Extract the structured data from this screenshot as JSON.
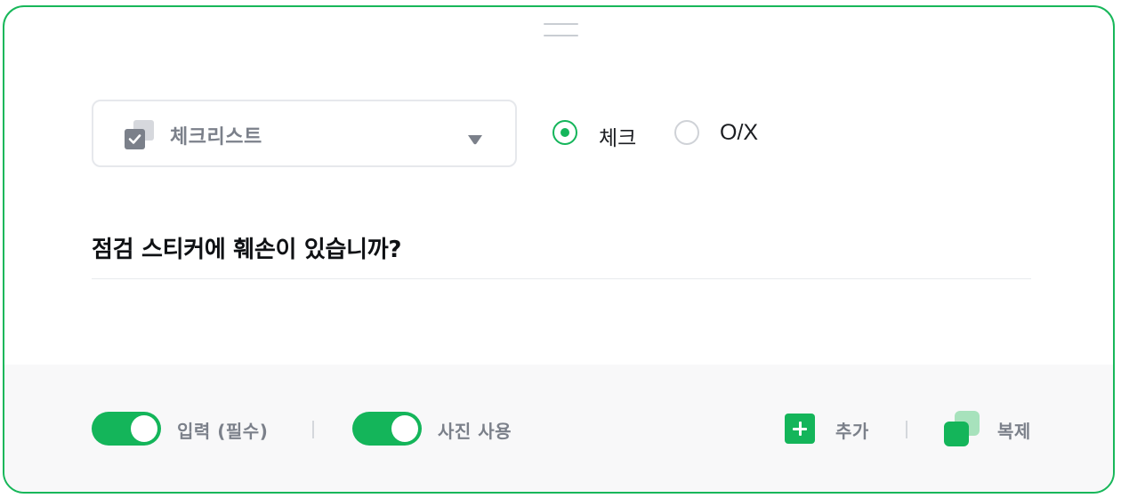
{
  "question_type": {
    "selected_label": "체크리스트",
    "icon": "checklist-icon"
  },
  "answer_style": {
    "options": [
      {
        "label": "체크",
        "selected": true
      },
      {
        "label": "O/X",
        "selected": false
      }
    ]
  },
  "question": {
    "text": "점검 스티커에 훼손이 있습니까?"
  },
  "footer": {
    "required_toggle": {
      "label": "입력 (필수)",
      "on": true
    },
    "photo_toggle": {
      "label": "사진 사용",
      "on": true
    },
    "add_label": "추가",
    "duplicate_label": "복제"
  },
  "colors": {
    "accent": "#14b55a",
    "border": "#18b75a",
    "muted_text": "#7b808a",
    "footer_bg": "#f8f8f9"
  }
}
